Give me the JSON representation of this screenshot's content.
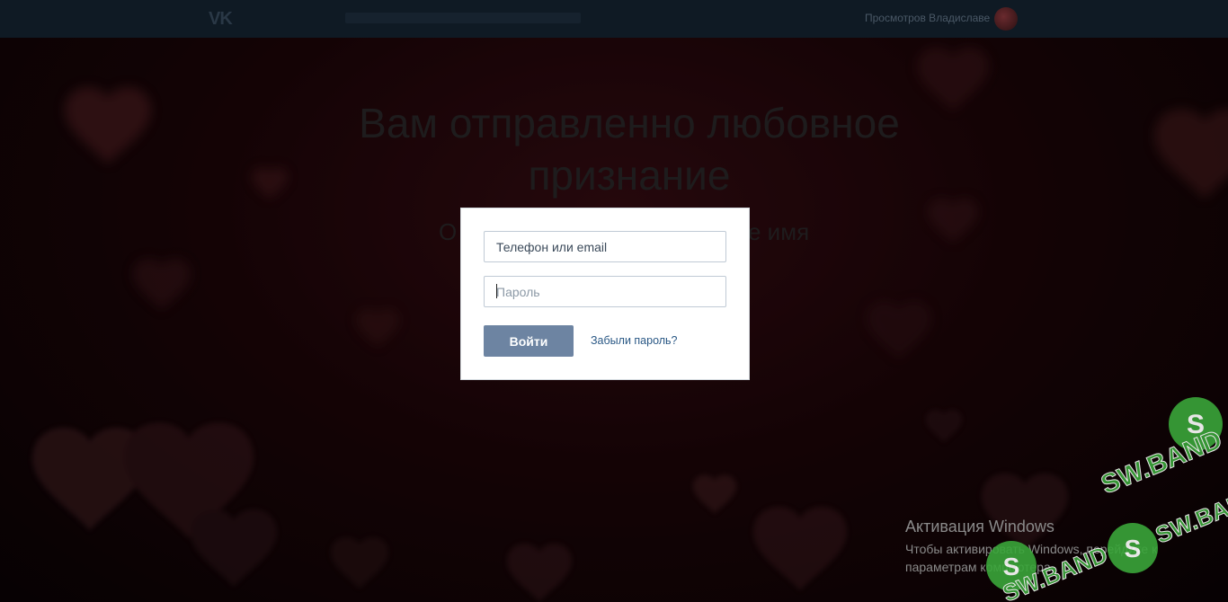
{
  "topbar": {
    "logo_text": "VK",
    "user_name": "Просмотров Владиславе"
  },
  "background": {
    "headline": "Вам отправленно любовное признание",
    "subline_left": "О",
    "subline_right": "е имя"
  },
  "login_form": {
    "login_value": "Телефон или email",
    "password_placeholder": "Пароль",
    "submit_label": "Войти",
    "forgot_label": "Забыли пароль?"
  },
  "windows_activation": {
    "title": "Активация Windows",
    "description": "Чтобы активировать Windows, перейдите к параметрам компьютера."
  },
  "watermark": {
    "brand_text": "SW.BAND"
  },
  "colors": {
    "accent_button": "#6d84a2",
    "link": "#2a5885",
    "watermark_green": "#3aa63a"
  }
}
